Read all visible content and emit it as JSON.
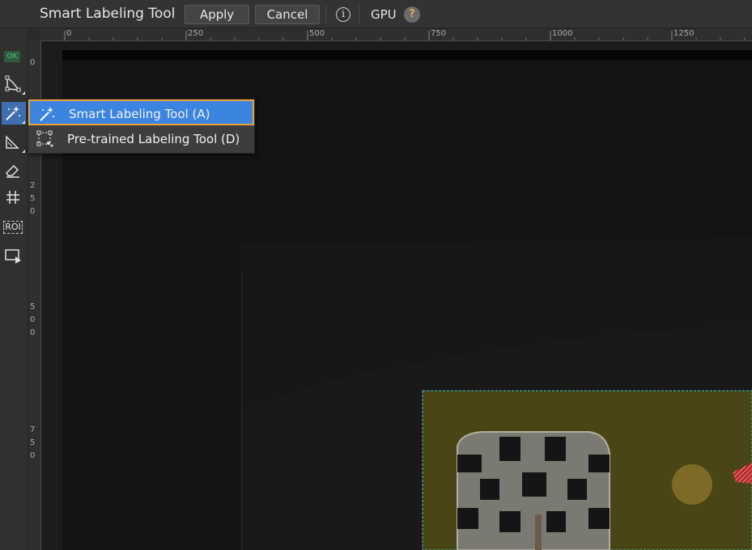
{
  "header": {
    "title": "Smart Labeling Tool",
    "apply_label": "Apply",
    "cancel_label": "Cancel",
    "info_icon": "i",
    "gpu_label": "GPU",
    "help_icon": "?"
  },
  "toolbar": {
    "ok_badge": "OK",
    "tools": [
      "polygon-tool-icon",
      "magic-wand-icon",
      "ruler-tool-icon",
      "eraser-icon",
      "grid-icon",
      "roi-icon",
      "region-play-icon"
    ],
    "roi_label": "ROI"
  },
  "ruler_top": {
    "ticks": [
      "0",
      "250",
      "500",
      "750",
      "1000",
      "1250"
    ]
  },
  "ruler_left": {
    "ticks": [
      "0",
      "250",
      "500",
      "750"
    ]
  },
  "dropdown": {
    "items": [
      {
        "label": "Smart Labeling Tool (A)",
        "icon": "magic-wand-icon",
        "selected": true
      },
      {
        "label": "Pre-trained Labeling Tool (D)",
        "icon": "pretrained-icon",
        "selected": false
      }
    ]
  },
  "colors": {
    "accent": "#3b84e0",
    "selection_border": "#e8a23a",
    "roi_dashed": "#3fc1c9",
    "label_red": "#d13a3a"
  }
}
